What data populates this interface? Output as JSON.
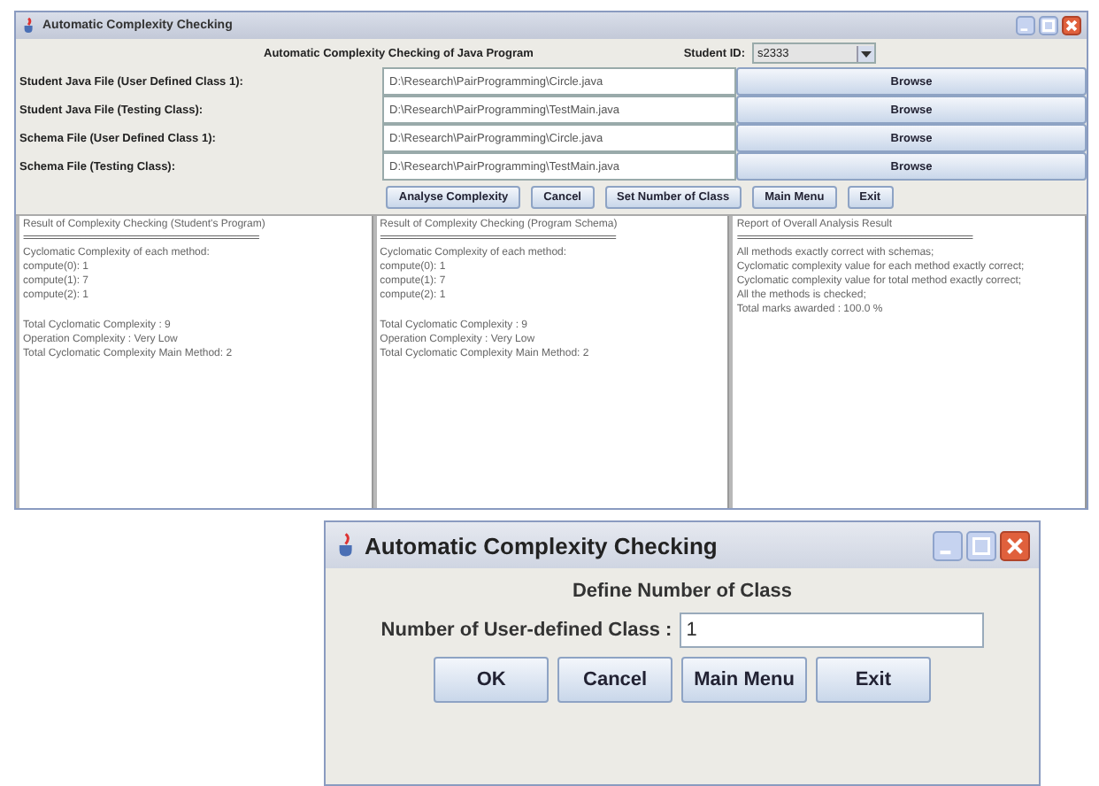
{
  "main_window": {
    "title": "Automatic Complexity Checking",
    "heading": "Automatic Complexity Checking of Java Program",
    "student_id": {
      "label": "Student ID:",
      "value": "s2333"
    },
    "files": [
      {
        "label": "Student Java File (User Defined Class 1):",
        "value": "D:\\Research\\PairProgramming\\Circle.java",
        "button": "Browse"
      },
      {
        "label": "Student Java File (Testing Class):",
        "value": "D:\\Research\\PairProgramming\\TestMain.java",
        "button": "Browse"
      },
      {
        "label": "Schema File (User Defined Class 1):",
        "value": "D:\\Research\\PairProgramming\\Circle.java",
        "button": "Browse"
      },
      {
        "label": "Schema File (Testing Class):",
        "value": "D:\\Research\\PairProgramming\\TestMain.java",
        "button": "Browse"
      }
    ],
    "buttons": [
      "Analyse Complexity",
      "Cancel",
      "Set Number of Class",
      "Main Menu",
      "Exit"
    ],
    "panels": [
      {
        "heading": "Result of Complexity Checking (Student's Program)",
        "separator": "=====================================================",
        "groups": [
          [
            "Cyclomatic Complexity of each method:",
            "compute(0): 1",
            "compute(1): 7",
            "compute(2): 1"
          ],
          [
            "Total Cyclomatic Complexity : 9",
            "Operation Complexity : Very Low",
            "Total Cyclomatic Complexity Main Method: 2"
          ]
        ]
      },
      {
        "heading": "Result of Complexity Checking (Program Schema)",
        "separator": "=====================================================",
        "groups": [
          [
            "Cyclomatic Complexity of each method:",
            "compute(0): 1",
            "compute(1): 7",
            "compute(2): 1"
          ],
          [
            "Total Cyclomatic Complexity : 9",
            "Operation Complexity : Very Low",
            "Total Cyclomatic Complexity Main Method: 2"
          ]
        ]
      },
      {
        "heading": "Report of Overall Analysis Result",
        "separator": "=====================================================",
        "groups": [
          [
            "All methods exactly correct with schemas;",
            "Cyclomatic complexity value for each method exactly correct;",
            "Cyclomatic complexity value for total method exactly correct;",
            "All the methods is checked;",
            "Total marks awarded : 100.0 %"
          ]
        ]
      }
    ]
  },
  "dialog": {
    "title": "Automatic Complexity Checking",
    "heading": "Define Number of Class",
    "field": {
      "label": "Number of User-defined Class :",
      "value": "1"
    },
    "buttons": [
      "OK",
      "Cancel",
      "Main Menu",
      "Exit"
    ]
  }
}
